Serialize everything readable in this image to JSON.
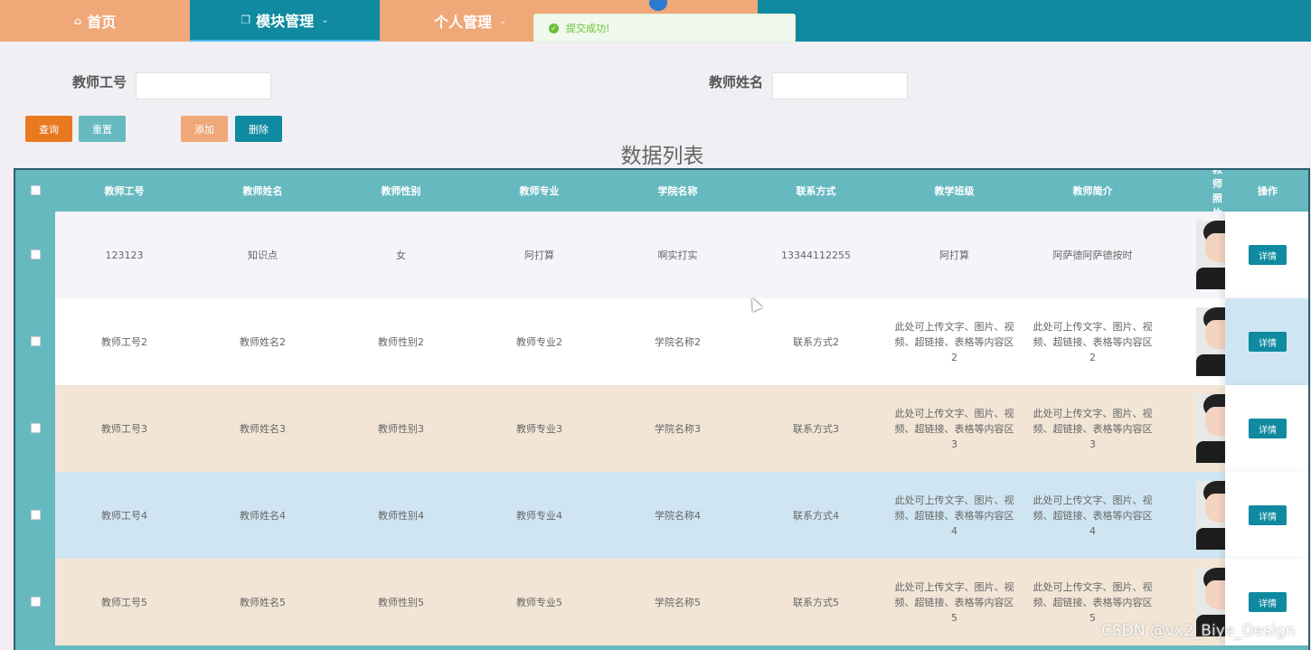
{
  "nav": {
    "home": "首页",
    "module": "模块管理",
    "personal": "个人管理"
  },
  "toast": {
    "message": "提交成功!"
  },
  "search": {
    "teacher_id_label": "教师工号",
    "teacher_id_value": "",
    "teacher_name_label": "教师姓名",
    "teacher_name_value": ""
  },
  "buttons": {
    "query": "查询",
    "reset": "重置",
    "add": "添加",
    "delete": "删除"
  },
  "list_title": "数据列表",
  "table": {
    "headers": [
      "教师工号",
      "教师姓名",
      "教师性别",
      "教师专业",
      "学院名称",
      "联系方式",
      "教学班级",
      "教师简介",
      "教师照片",
      "操作"
    ],
    "detail_label": "详情",
    "rows": [
      {
        "id": "123123",
        "name": "知识点",
        "gender": "女",
        "major": "阿打算",
        "college": "啊实打实",
        "phone": "13344112255",
        "class": "阿打算",
        "intro": "阿萨德阿萨德按时"
      },
      {
        "id": "教师工号2",
        "name": "教师姓名2",
        "gender": "教师性别2",
        "major": "教师专业2",
        "college": "学院名称2",
        "phone": "联系方式2",
        "class": "此处可上传文字、图片、视频、超链接、表格等内容区2",
        "intro": "此处可上传文字、图片、视频、超链接、表格等内容区2"
      },
      {
        "id": "教师工号3",
        "name": "教师姓名3",
        "gender": "教师性别3",
        "major": "教师专业3",
        "college": "学院名称3",
        "phone": "联系方式3",
        "class": "此处可上传文字、图片、视频、超链接、表格等内容区3",
        "intro": "此处可上传文字、图片、视频、超链接、表格等内容区3"
      },
      {
        "id": "教师工号4",
        "name": "教师姓名4",
        "gender": "教师性别4",
        "major": "教师专业4",
        "college": "学院名称4",
        "phone": "联系方式4",
        "class": "此处可上传文字、图片、视频、超链接、表格等内容区4",
        "intro": "此处可上传文字、图片、视频、超链接、表格等内容区4"
      },
      {
        "id": "教师工号5",
        "name": "教师姓名5",
        "gender": "教师性别5",
        "major": "教师专业5",
        "college": "学院名称5",
        "phone": "联系方式5",
        "class": "此处可上传文字、图片、视频、超链接、表格等内容区5",
        "intro": "此处可上传文字、图片、视频、超链接、表格等内容区5"
      }
    ],
    "row_colors": [
      "#f6f4f8",
      "#ffffff",
      "#f2e5d6",
      "#cfe6f2",
      "#f2e5d6"
    ],
    "ops_colors": [
      "#ffffff",
      "#cfe6f2",
      "#ffffff",
      "#ffffff",
      "#ffffff"
    ]
  },
  "watermark": "CSDN @vx2_Biye_Design",
  "colors": {
    "primary": "#0f8aa0",
    "accent": "#f0a878",
    "header": "#67b9c0",
    "success": "#67c23a"
  }
}
